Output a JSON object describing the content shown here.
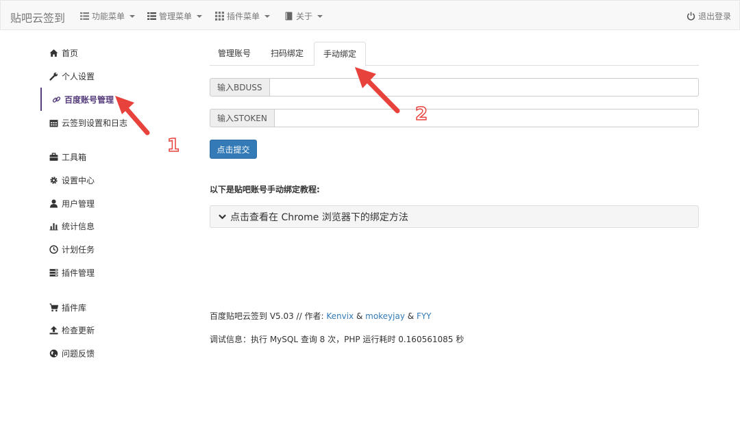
{
  "navbar": {
    "brand": "贴吧云签到",
    "menus": [
      {
        "label": "功能菜单",
        "icon": "list-icon"
      },
      {
        "label": "管理菜单",
        "icon": "list-icon"
      },
      {
        "label": "插件菜单",
        "icon": "grid-icon"
      },
      {
        "label": "关于",
        "icon": "book-icon"
      }
    ],
    "logout_label": "退出登录"
  },
  "sidebar": {
    "items": [
      {
        "label": "首页",
        "icon": "home-icon"
      },
      {
        "label": "个人设置",
        "icon": "wrench-icon"
      },
      {
        "label": "百度账号管理",
        "icon": "link-icon",
        "active": true
      },
      {
        "label": "云签到设置和日志",
        "icon": "calendar-icon"
      },
      {
        "label": "工具箱",
        "icon": "briefcase-icon"
      },
      {
        "label": "设置中心",
        "icon": "gear-icon"
      },
      {
        "label": "用户管理",
        "icon": "user-icon"
      },
      {
        "label": "统计信息",
        "icon": "stats-icon"
      },
      {
        "label": "计划任务",
        "icon": "clock-icon"
      },
      {
        "label": "插件管理",
        "icon": "tasks-icon"
      },
      {
        "label": "插件库",
        "icon": "cart-icon"
      },
      {
        "label": "检查更新",
        "icon": "upload-icon"
      },
      {
        "label": "问题反馈",
        "icon": "globe-icon"
      }
    ]
  },
  "tabs": [
    {
      "label": "管理账号"
    },
    {
      "label": "扫码绑定"
    },
    {
      "label": "手动绑定",
      "active": true
    }
  ],
  "form": {
    "bduss_label": "输入BDUSS",
    "bduss_value": "",
    "stoken_label": "输入STOKEN",
    "stoken_value": "",
    "submit_label": "点击提交"
  },
  "tutorial": {
    "title": "以下是贴吧账号手动绑定教程:",
    "panel_label": "点击查看在 Chrome 浏览器下的绑定方法"
  },
  "footer": {
    "version_prefix": "百度贴吧云签到 V5.03 // 作者: ",
    "author1": "Kenvix",
    "amp1": " & ",
    "author2": "mokeyjay",
    "amp2": " & ",
    "author3": "FYY",
    "debug": "调试信息：执行 MySQL 查询 8 次，PHP 运行耗时 0.160561085 秒"
  },
  "annotations": {
    "arrow1_number": "1",
    "arrow2_number": "2"
  },
  "colors": {
    "accent_purple": "#563d7c",
    "primary_blue": "#337ab7",
    "annotation_red": "#e8423c"
  }
}
